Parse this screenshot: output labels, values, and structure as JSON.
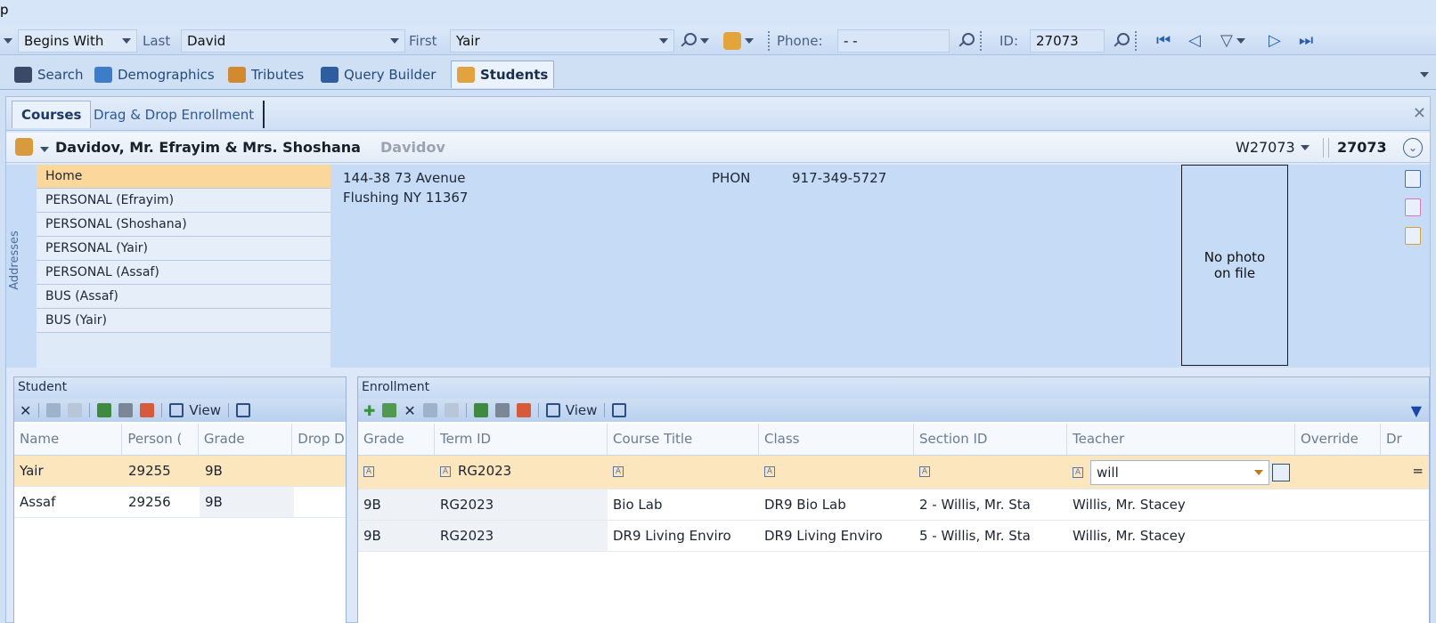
{
  "title_char": "p",
  "search": {
    "mode": "Begins With",
    "last_label": "Last",
    "last_value": "David",
    "first_label": "First",
    "first_value": "Yair",
    "phone_label": "Phone:",
    "phone_value": "-  -",
    "id_label": "ID:",
    "id_value": "27073"
  },
  "main_tabs": [
    {
      "label": "Search"
    },
    {
      "label": "Demographics"
    },
    {
      "label": "Tributes"
    },
    {
      "label": "Query Builder"
    },
    {
      "label": "Students"
    }
  ],
  "sub_tabs": [
    {
      "label": "Courses"
    },
    {
      "label": "Drag & Drop Enrollment"
    }
  ],
  "header": {
    "name": "Davidov,  Mr. Efrayim  &  Mrs. Shoshana",
    "grey_name": "Davidov",
    "account": "W27073",
    "id": "27073"
  },
  "addresses": {
    "label": "Addresses",
    "items": [
      "Home",
      "PERSONAL (Efrayim)",
      "PERSONAL (Shoshana)",
      "PERSONAL (Yair)",
      "PERSONAL (Assaf)",
      "BUS (Assaf)",
      "BUS (Yair)"
    ],
    "line1": "144-38 73 Avenue",
    "line2": "Flushing NY 11367",
    "phone_type": "PHON",
    "phone": "917-349-5727",
    "photo_line1": "No photo",
    "photo_line2": "on file"
  },
  "student_panel": {
    "title": "Student",
    "view_label": "View",
    "columns": [
      "Name",
      "Person (",
      "Grade",
      "Drop D"
    ],
    "rows": [
      {
        "name": "Yair",
        "person": "29255",
        "grade": "9B"
      },
      {
        "name": "Assaf",
        "person": "29256",
        "grade": "9B"
      }
    ]
  },
  "enrollment_panel": {
    "title": "Enrollment",
    "view_label": "View",
    "columns": [
      "Grade",
      "Term ID",
      "Course Title",
      "Class",
      "Section ID",
      "Teacher",
      "Override",
      "Dr"
    ],
    "filter_row": {
      "term": "RG2023",
      "teacher": "will"
    },
    "rows": [
      {
        "grade": "9B",
        "term": "RG2023",
        "course": "Bio Lab",
        "class": "DR9 Bio Lab",
        "section": "2 - Willis, Mr. Sta",
        "teacher": "Willis, Mr. Stacey"
      },
      {
        "grade": "9B",
        "term": "RG2023",
        "course": "DR9 Living Enviro",
        "class": "DR9 Living Enviro",
        "section": "5 - Willis, Mr. Sta",
        "teacher": "Willis, Mr. Stacey"
      }
    ]
  }
}
